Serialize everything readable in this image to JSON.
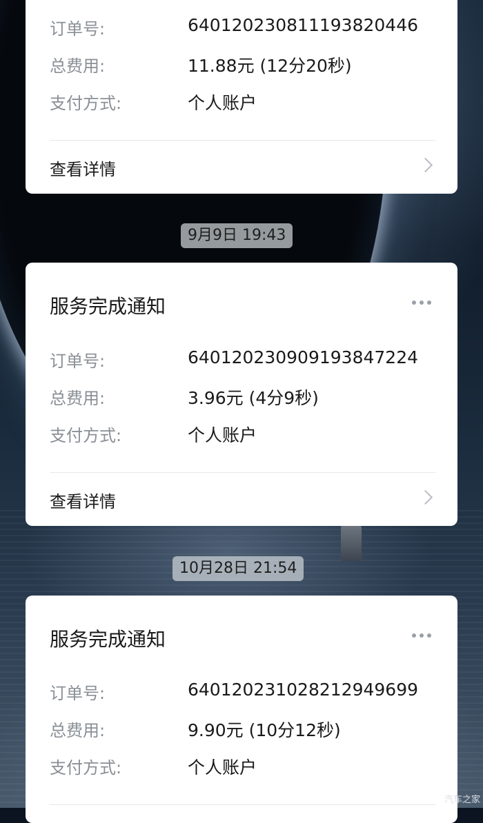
{
  "cards": [
    {
      "rows": [
        {
          "label": "订单号:",
          "value": "6401202308111938204​46"
        },
        {
          "label": "总费用:",
          "value": "11.88元 (12分20秒)"
        },
        {
          "label": "支付方式:",
          "value": "个人账户"
        }
      ],
      "detail_label": "查看详情"
    },
    {
      "title": "服务完成通知",
      "rows": [
        {
          "label": "订单号:",
          "value": "640120230909193847224"
        },
        {
          "label": "总费用:",
          "value": "3.96元 (4分9秒)"
        },
        {
          "label": "支付方式:",
          "value": "个人账户"
        }
      ],
      "detail_label": "查看详情"
    },
    {
      "title": "服务完成通知",
      "rows": [
        {
          "label": "订单号:",
          "value": "640120231028212949699"
        },
        {
          "label": "总费用:",
          "value": "9.90元 (10分12秒)"
        },
        {
          "label": "支付方式:",
          "value": "个人账户"
        }
      ]
    }
  ],
  "timestamps": [
    "9月9日 19:43",
    "10月28日 21:54"
  ],
  "watermark": "汽车之家"
}
